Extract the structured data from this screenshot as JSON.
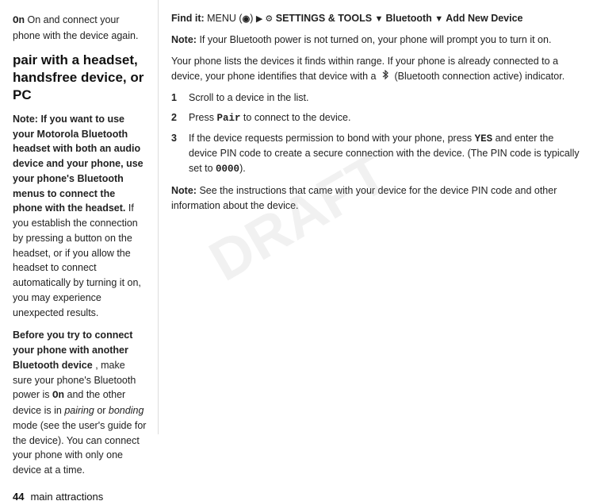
{
  "watermark": "DRAFT",
  "left": {
    "intro_text": "On and connect your phone with the device again.",
    "section_heading": "pair with a headset, handsfree device, or PC",
    "note1_label": "Note:",
    "note1_bold": "If you want to use your Motorola Bluetooth headset with both an audio device and your phone, use your phone's Bluetooth menus to connect the phone with the headset.",
    "note1_rest": " If you establish the connection by pressing a button on the headset, or if you allow the headset to connect automatically by turning it on, you may experience unexpected results.",
    "para2_bold": "Before you try to connect your phone with another Bluetooth device",
    "para2_rest": ", make sure your phone's Bluetooth power is On and the other device is in pairing or bonding mode (see the user's guide for the device). You can connect your phone with only one device at a time.",
    "footer_number": "44",
    "footer_label": "main attractions"
  },
  "right": {
    "find_label": "Find it:",
    "find_menu": "MENU",
    "find_arrow1": "▶",
    "find_settings": "SETTINGS & TOOLS",
    "find_arrow2": "▼",
    "find_bluetooth": "Bluetooth",
    "find_arrow3": "▼",
    "find_add": "Add New Device",
    "note2_label": "Note:",
    "note2_text": " If your Bluetooth power is not turned on, your phone will prompt you to turn it on.",
    "para3": "Your phone lists the devices it finds within range. If your phone is already connected to a device, your phone identifies that device with a",
    "para3_icon_desc": "bluetooth-connection-icon",
    "para3_end": "(Bluetooth connection active) indicator.",
    "steps": [
      {
        "num": "1",
        "text": "Scroll to a device in the list."
      },
      {
        "num": "2",
        "text_pre": "Press ",
        "text_code": "Pair",
        "text_post": " to connect to the device."
      },
      {
        "num": "3",
        "text_pre": "If the device requests permission to bond with your phone, press ",
        "text_code": "YES",
        "text_mid": " and enter the device PIN code to create a secure connection with the device. (The PIN code is typically set to ",
        "text_code2": "0000",
        "text_post": ")."
      }
    ],
    "note3_label": "Note:",
    "note3_text": " See the instructions that came with your device for the device PIN code and other information about the device."
  }
}
